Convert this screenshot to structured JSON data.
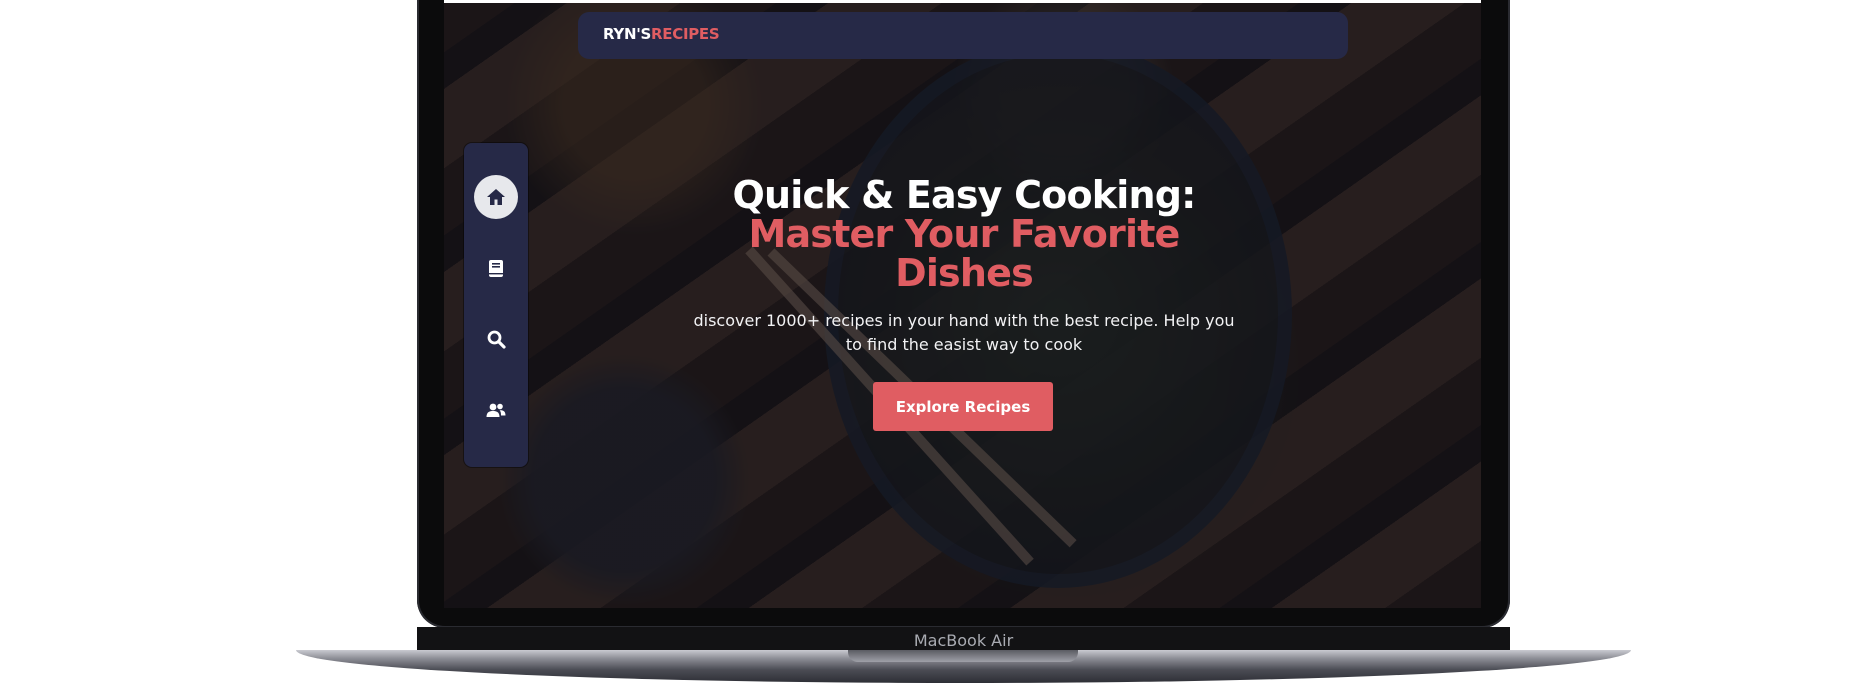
{
  "device": {
    "label": "MacBook Air"
  },
  "navbar": {
    "logo_primary": "RYN'S",
    "logo_accent": "RECIPES"
  },
  "sidebar": {
    "items": [
      {
        "icon": "home-icon",
        "active": true
      },
      {
        "icon": "book-icon",
        "active": false
      },
      {
        "icon": "search-icon",
        "active": false
      },
      {
        "icon": "users-icon",
        "active": false
      }
    ]
  },
  "hero": {
    "title_line1": "Quick & Easy Cooking:",
    "title_line2": "Master Your Favorite",
    "title_line3": "Dishes",
    "subtitle": "discover 1000+ recipes in your hand with the best recipe. Help you to find the easist way to cook",
    "cta_label": "Explore Recipes"
  },
  "colors": {
    "primary_dark": "#262947",
    "accent": "#e05d62",
    "text_light": "#ffffff"
  }
}
